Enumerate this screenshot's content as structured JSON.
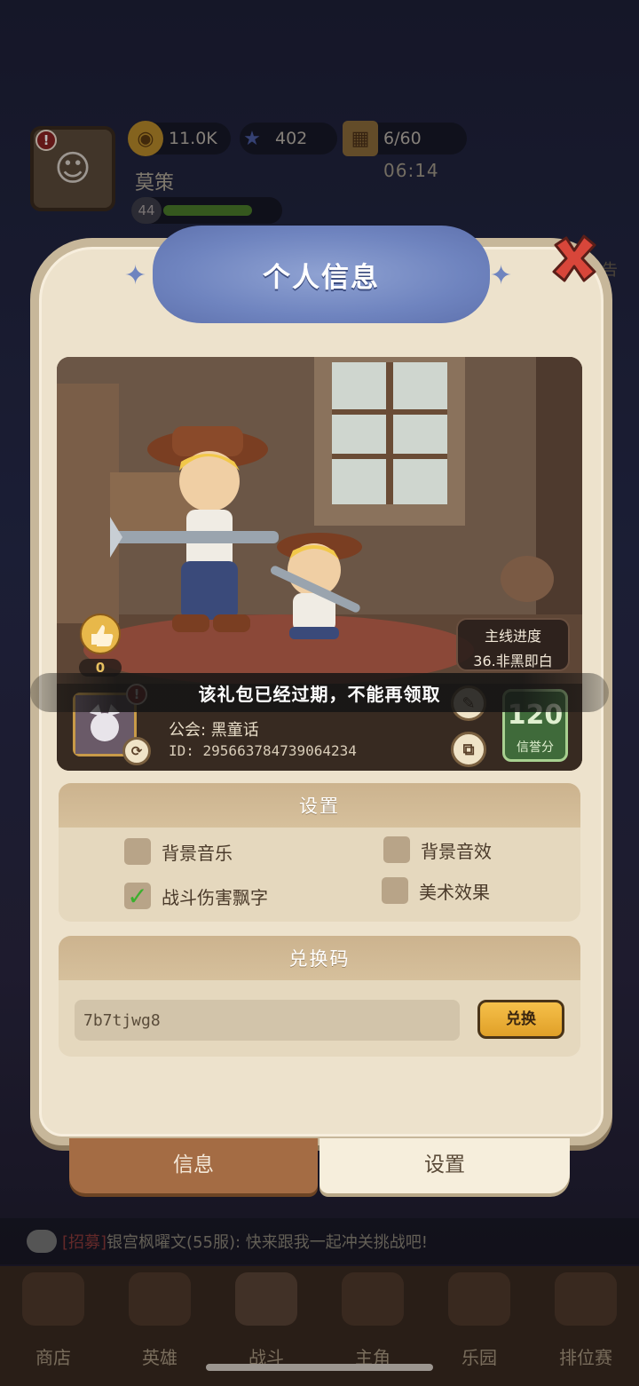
{
  "hud": {
    "gold": "11.0K",
    "gems": "402",
    "stamina": "6/60",
    "timer": "06:14",
    "player_name": "莫策",
    "level": "44",
    "right_edge_label": "告"
  },
  "modal": {
    "title": "个人信息",
    "progress_label": "主线进度",
    "progress_value": "36.非黑即白",
    "likes": "0",
    "guild": "公会: 黑童话",
    "player_id": "ID: 295663784739064234",
    "credit_score": "120",
    "credit_label": "信誉分",
    "toast": "该礼包已经过期，不能再领取"
  },
  "settings": {
    "header": "设置",
    "options": [
      {
        "label": "背景音乐",
        "checked": false
      },
      {
        "label": "背景音效",
        "checked": false
      },
      {
        "label": "战斗伤害飘字",
        "checked": true
      },
      {
        "label": "美术效果",
        "checked": false
      }
    ]
  },
  "redeem": {
    "header": "兑换码",
    "code_value": "7b7tjwg8",
    "button": "兑换"
  },
  "tabs": {
    "info": "信息",
    "settings": "设置"
  },
  "chat": {
    "tag": "[招募]",
    "message": "银宫枫曜文(55服): 快来跟我一起冲关挑战吧!"
  },
  "nav": {
    "items": [
      "商店",
      "英雄",
      "战斗",
      "主角",
      "乐园",
      "排位赛"
    ]
  },
  "colors": {
    "panel_bg": "#ede2cc",
    "title_banner": "#6f84bf",
    "accent_button": "#f6c04a",
    "credit_green": "#3f6a3a",
    "checkbox_tick": "#3bb02e"
  }
}
